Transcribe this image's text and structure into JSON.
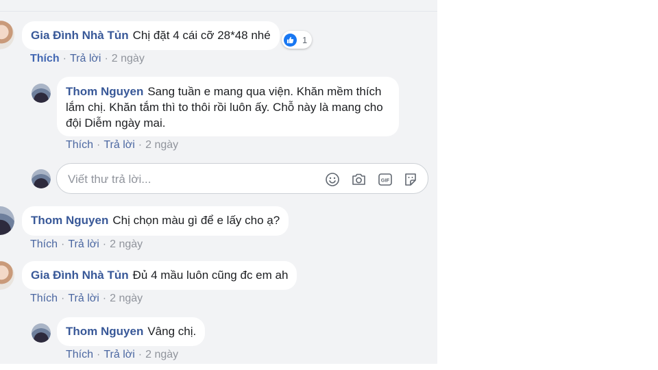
{
  "comments": [
    {
      "author": "Gia Đình Nhà Tủn",
      "text": "Chị đặt 4 cái cỡ 28*48 nhé",
      "like_label": "Thích",
      "reply_label": "Trả lời",
      "time": "2 ngày",
      "reaction_count": "1"
    },
    {
      "author": "Thom Nguyen",
      "text": "Sang tuần e mang qua viện. Khăn mềm thích lắm chị. Khăn tắm thì to thôi rồi luôn ấy. Chỗ này là mang cho đội Diễm ngày mai.",
      "like_label": "Thích",
      "reply_label": "Trả lời",
      "time": "2 ngày"
    },
    {
      "author": "Thom Nguyen",
      "text": "Chị chọn màu gì để e lấy cho ạ?",
      "like_label": "Thích",
      "reply_label": "Trả lời",
      "time": "2 ngày"
    },
    {
      "author": "Gia Đình Nhà Tủn",
      "text": "Đủ 4 mầu luôn cũng đc em ah",
      "like_label": "Thích",
      "reply_label": "Trả lời",
      "time": "2 ngày"
    },
    {
      "author": "Thom Nguyen",
      "text": "Vâng chị.",
      "like_label": "Thích",
      "reply_label": "Trả lời",
      "time": "2 ngày"
    }
  ],
  "reply_box": {
    "placeholder": "Viết thư trả lời...",
    "icons": [
      "smiley-icon",
      "camera-icon",
      "gif-icon",
      "sticker-icon"
    ]
  },
  "colors": {
    "author": "#385898",
    "link": "#4b67a1",
    "like_active": "#4267b2",
    "meta": "#90949c",
    "feed_bg": "#f2f3f5",
    "bubble_bg": "#ffffff",
    "reaction_blue": "#1877f2"
  }
}
